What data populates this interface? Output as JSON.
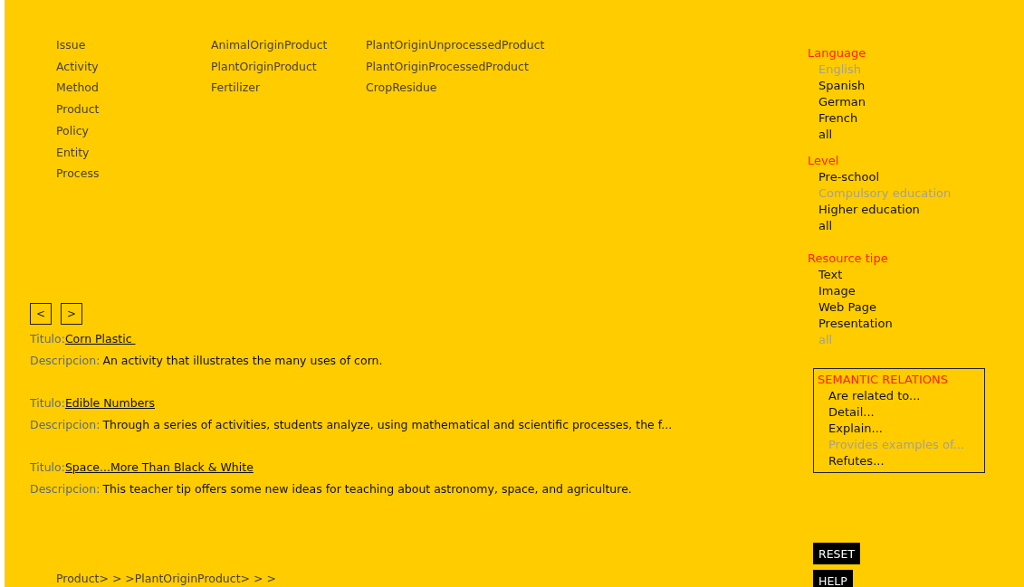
{
  "category_columns": [
    {
      "items": [
        "Issue",
        "Activity",
        "Method",
        "Product",
        "Policy",
        "Entity",
        "Process"
      ]
    },
    {
      "items": [
        "AnimalOriginProduct",
        "PlantOriginProduct",
        "Fertilizer"
      ]
    },
    {
      "items": [
        "PlantOriginUnprocessedProduct",
        "PlantOriginProcessedProduct",
        "CropResidue"
      ]
    }
  ],
  "pager": {
    "previous": "<",
    "next": ">"
  },
  "results": [
    {
      "title_label": "Titulo:",
      "title": "Corn Plastic ",
      "description_label": "Descripcion:",
      "description": "An activity that illustrates the many uses of corn."
    },
    {
      "title_label": "Titulo:",
      "title": "Edible Numbers",
      "description_label": "Descripcion:",
      "description": "Through a series of activities, students analyze, using mathematical and scientific processes, the f..."
    },
    {
      "title_label": "Titulo:",
      "title": "Space...More Than Black & White",
      "description_label": "Descripcion:",
      "description": "This teacher tip offers some new ideas for teaching about astronomy, space, and agriculture."
    }
  ],
  "breadcrumb": "Product> > >PlantOriginProduct> > >",
  "filters": [
    {
      "heading": "Language",
      "options": [
        {
          "label": "English",
          "selected": true
        },
        {
          "label": "Spanish",
          "selected": false
        },
        {
          "label": "German",
          "selected": false
        },
        {
          "label": "French",
          "selected": false
        },
        {
          "label": "all",
          "selected": false
        }
      ]
    },
    {
      "heading": "Level",
      "options": [
        {
          "label": "Pre-school",
          "selected": false
        },
        {
          "label": "Compulsory education",
          "selected": true
        },
        {
          "label": "Higher education",
          "selected": false
        },
        {
          "label": "all",
          "selected": false
        }
      ]
    },
    {
      "heading": "Resource tipe",
      "options": [
        {
          "label": "Text",
          "selected": false
        },
        {
          "label": "Image",
          "selected": false
        },
        {
          "label": "Web Page",
          "selected": false
        },
        {
          "label": "Presentation",
          "selected": false
        },
        {
          "label": "all",
          "selected": true
        }
      ]
    }
  ],
  "semantic_relations": {
    "heading": "SEMANTIC RELATIONS",
    "options": [
      {
        "label": "Are related to...",
        "selected": false
      },
      {
        "label": "Detail...",
        "selected": false
      },
      {
        "label": "Explain...",
        "selected": false
      },
      {
        "label": "Provides examples of...",
        "selected": true
      },
      {
        "label": "Refutes...",
        "selected": false
      }
    ]
  },
  "buttons": [
    "RESET",
    "HELP"
  ]
}
